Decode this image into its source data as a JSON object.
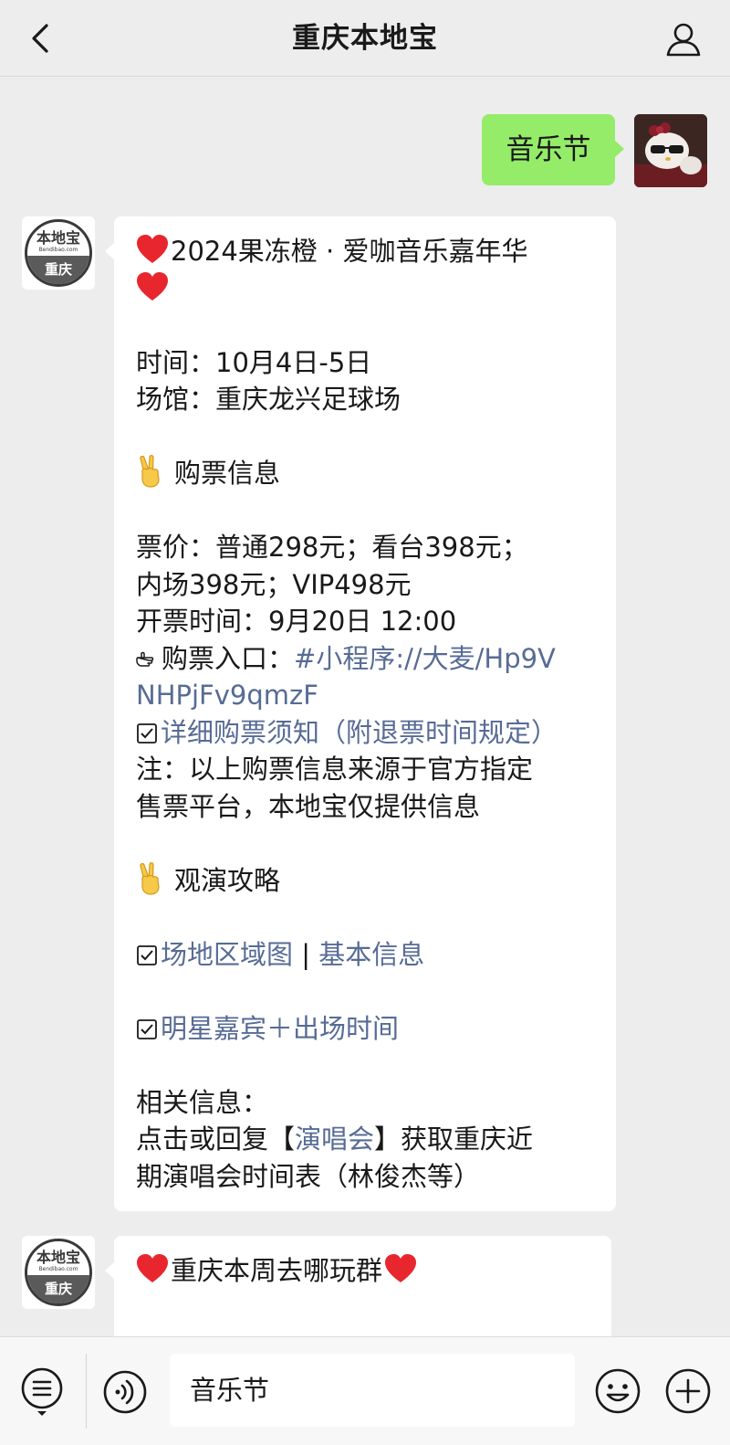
{
  "header": {
    "title": "重庆本地宝",
    "back_icon": "chevron-left-icon",
    "profile_icon": "person-icon"
  },
  "outgoing": {
    "text": "音乐节"
  },
  "bot_avatar": {
    "name": "本地宝",
    "domain": "Bendibao.com",
    "city": "重庆"
  },
  "message1": {
    "title": "2024果冻橙 · 爱咖音乐嘉年华",
    "time": "时间：10月4日-5日",
    "venue": "场馆：重庆龙兴足球场",
    "ticket_heading": "购票信息",
    "price_line1": "票价：普通298元；看台398元；",
    "price_line2": "内场398元；VIP498元",
    "sale_time": "开票时间：9月20日 12:00",
    "entry_label": "购票入口：",
    "entry_link_1": "#小程序://大麦/Hp9V",
    "entry_link_2": "NHPjFv9qmzF",
    "notice_link": "详细购票须知（附退票时间规定）",
    "note_line1": "注：以上购票信息来源于官方指定",
    "note_line2": "售票平台，本地宝仅提供信息",
    "guide_heading": "观演攻略",
    "venue_map_link": "场地区域图",
    "separator": " | ",
    "basic_info_link": "基本信息",
    "guests_link": "明星嘉宾＋出场时间",
    "related_heading": "相关信息：",
    "related_pre": "点击或回复【",
    "related_link": "演唱会",
    "related_post": "】获取重庆近",
    "related_line2": "期演唱会时间表（林俊杰等）"
  },
  "message2": {
    "title": "重庆本周去哪玩群"
  },
  "input_bar": {
    "value": "音乐节",
    "menu_icon": "menu-list-icon",
    "voice_icon": "voice-icon",
    "emoji_icon": "emoji-icon",
    "plus_icon": "plus-icon"
  },
  "colors": {
    "background": "#ededed",
    "outgoing_bubble": "#95ec69",
    "link": "#576b95",
    "heart": "#e8262d"
  }
}
